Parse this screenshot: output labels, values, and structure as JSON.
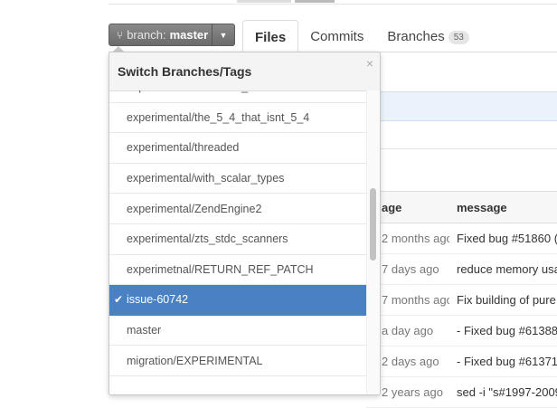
{
  "branch_button": {
    "label": "branch:",
    "name": "master"
  },
  "tabs": [
    {
      "label": "Files",
      "active": true
    },
    {
      "label": "Commits",
      "active": false
    },
    {
      "label": "Branches",
      "active": false,
      "count": "53"
    }
  ],
  "dropdown": {
    "title": "Switch Branches/Tags",
    "close": "×",
    "items": [
      {
        "label": "experimental/RETURN_REF",
        "selected": false
      },
      {
        "label": "experimental/the_5_4_that_isnt_5_4",
        "selected": false
      },
      {
        "label": "experimental/threaded",
        "selected": false
      },
      {
        "label": "experimental/with_scalar_types",
        "selected": false
      },
      {
        "label": "experimental/ZendEngine2",
        "selected": false
      },
      {
        "label": "experimental/zts_stdc_scanners",
        "selected": false
      },
      {
        "label": "experimetnal/RETURN_REF_PATCH",
        "selected": false
      },
      {
        "label": "issue-60742",
        "selected": true
      },
      {
        "label": "master",
        "selected": false
      },
      {
        "label": "migration/EXPERIMENTAL",
        "selected": false
      },
      {
        "label": "",
        "selected": false
      }
    ]
  },
  "file_table": {
    "headers": {
      "age": "age",
      "message": "message"
    },
    "rows": [
      {
        "age": "2 months ago",
        "message": "Fixed bug #51860 ("
      },
      {
        "age": "7 days ago",
        "message": "reduce memory usa"
      },
      {
        "age": "7 months ago",
        "message": "Fix building of pure"
      },
      {
        "age": "a day ago",
        "message": "- Fixed bug #61388"
      },
      {
        "age": "2 days ago",
        "message": "- Fixed bug #61371"
      },
      {
        "age": "2 years ago",
        "message": "sed -i \"s#1997-2009"
      }
    ]
  },
  "colors": {
    "selected_item": "#4a81c4",
    "row_highlight": "#eaf3fb"
  }
}
